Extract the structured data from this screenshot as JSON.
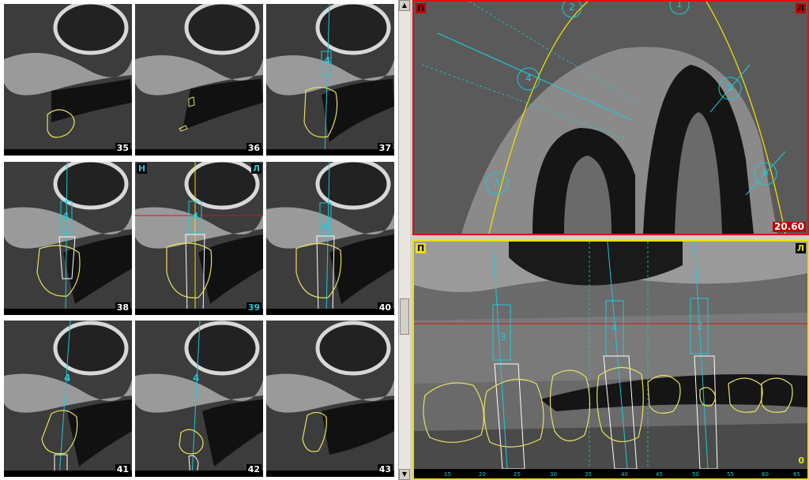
{
  "slices": [
    {
      "number": "35"
    },
    {
      "number": "36"
    },
    {
      "number": "37"
    },
    {
      "number": "38"
    },
    {
      "number": "39"
    },
    {
      "number": "40"
    },
    {
      "number": "41"
    },
    {
      "number": "42"
    },
    {
      "number": "43"
    }
  ],
  "active_slice": {
    "corner_left": "Н",
    "corner_right": "Л"
  },
  "implant_marks": {
    "slice37": "4",
    "slice38": "4",
    "slice39": "4",
    "slice40": "4",
    "slice41": "4",
    "slice42": "4"
  },
  "axial_view": {
    "corner_left": "П",
    "corner_right": "Л",
    "depth_value": "20.60",
    "implant_markers": [
      "2",
      "4",
      "5",
      "3",
      "6",
      "1"
    ]
  },
  "panoramic_view": {
    "corner_left": "П",
    "corner_right": "Л",
    "zero_label": "0",
    "implant_labels": [
      "3",
      "4",
      "2"
    ],
    "scale_ticks": [
      "15",
      "20",
      "25",
      "30",
      "35",
      "40",
      "45",
      "50",
      "55",
      "60",
      "65"
    ]
  },
  "colors": {
    "accent_cyan": "#1ec8d8",
    "outline_yellow": "#e8e060",
    "axial_border": "#e01010",
    "pano_border": "#e8e000"
  }
}
